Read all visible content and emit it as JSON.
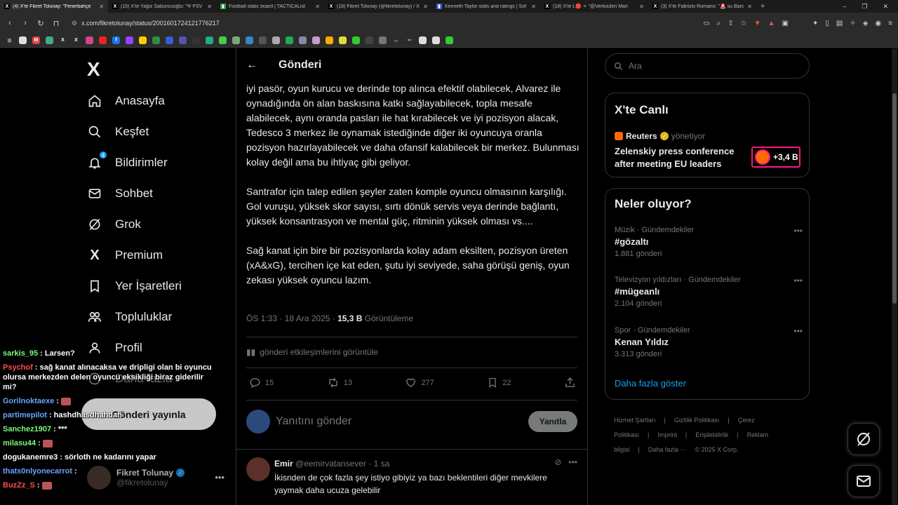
{
  "browser": {
    "tabs": [
      {
        "title": "(4) X'te Fikret Tolunay: \"Fenerbahçe",
        "fav": "X",
        "fav_color": "#000000",
        "active": true
      },
      {
        "title": "(15) X'te Yağız Sabuncuoğlu: \"Ψ PSV",
        "fav": "X",
        "fav_color": "#000000",
        "active": false
      },
      {
        "title": "Football static board | TACTICAList",
        "fav": "▮",
        "fav_color": "#2e9e44",
        "active": false
      },
      {
        "title": "(18) Fikret Tolunay (@fikretolunay) / X",
        "fav": "X",
        "fav_color": "#000000",
        "active": false
      },
      {
        "title": "Kenneth Taylor stats and ratings | Sof",
        "fav": "▮",
        "fav_color": "#3a5bd9",
        "active": false
      },
      {
        "title": "(18) X'te L🔴 ⚪ \"@Verkoulen Mari",
        "fav": "X",
        "fav_color": "#000000",
        "active": false
      },
      {
        "title": "(3) X'te Fabrizio Romano: \"🚨 su Barc",
        "fav": "X",
        "fav_color": "#000000",
        "active": false
      }
    ],
    "new_tab": "+",
    "window_controls": [
      "–",
      "❐",
      "✕"
    ],
    "url": "x.com/fikretolunay/status/2001601724121776217"
  },
  "nav": {
    "logo": "X",
    "items": [
      {
        "label": "Anasayfa",
        "icon": "home-icon"
      },
      {
        "label": "Keşfet",
        "icon": "search-icon"
      },
      {
        "label": "Bildirimler",
        "icon": "bell-icon",
        "badge": "4"
      },
      {
        "label": "Sohbet",
        "icon": "mail-icon"
      },
      {
        "label": "Grok",
        "icon": "grok-icon"
      },
      {
        "label": "Premium",
        "icon": "x-premium-icon"
      },
      {
        "label": "Yer İşaretleri",
        "icon": "bookmark-icon"
      },
      {
        "label": "Topluluklar",
        "icon": "people-icon"
      },
      {
        "label": "Profil",
        "icon": "person-icon"
      },
      {
        "label": "Daha fazla",
        "icon": "more-circle-icon"
      }
    ],
    "post_button": "Gönderi yayınla",
    "profile": {
      "name": "Fikret Tolunay",
      "handle": "@fikretolunay",
      "more": "•••"
    }
  },
  "chat": [
    {
      "user": "sarkis_95",
      "color": "#7cfc7c",
      "text": ": Larsen?"
    },
    {
      "user": "Psychof",
      "color": "#ff4d4d",
      "text": ": sağ kanat alınacaksa ve dripligi olan bi oyuncu olursa merkezden delen oyuncu eksikliği biraz giderilir mi?"
    },
    {
      "user": "Gorilnoktaexe",
      "color": "#6aa3ff",
      "text": ": ",
      "emote": true
    },
    {
      "user": "partimepilot",
      "color": "#6aa3ff",
      "text": ": hashdhasdhahdah"
    },
    {
      "user": "Sanchez1907",
      "color": "#7cfc7c",
      "text": ": ***"
    },
    {
      "user": "milasu44",
      "color": "#7cfc7c",
      "text": ": ",
      "emote": true
    },
    {
      "user": "dogukanemre3",
      "color": "#ffffff",
      "text": ": sörloth ne kadarını yapar"
    },
    {
      "user": "thats0nlyonecarrot",
      "color": "#6aa3ff",
      "text": ":"
    },
    {
      "user": "BuzZz_S",
      "color": "#ff4d4d",
      "text": ": ",
      "emote": true
    }
  ],
  "main": {
    "header_title": "Gönderi",
    "paragraphs": [
      "iyi pasör, oyun kurucu ve derinde top alınca efektif olabilecek, Alvarez ile oynadığında ön alan baskısına katkı sağlayabilecek, topla mesafe alabilecek, aynı oranda pasları ile hat kırabilecek ve iyi pozisyon alacak, Tedesco 3 merkez ile oynamak istediğinde diğer iki oyuncuya oranla pozisyon hazırlayabilecek ve daha ofansif kalabilecek bir merkez. Bulunması kolay değil ama bu ihtiyaç gibi geliyor.",
      "Santrafor için talep edilen şeyler zaten komple oyuncu olmasının karşılığı. Gol vuruşu, yüksek skor sayısı, sırtı dönük servis veya derinde bağlantı, yüksek konsantrasyon ve mental güç, ritminin yüksek olması vs....",
      "Sağ kanat için bire bir pozisyonlarda kolay adam eksilten, pozisyon üreten (xA&xG), tercihen içe kat eden, şutu iyi seviyede, saha görüşü geniş, oyun zekası yüksek oyuncu lazım."
    ],
    "meta_time": "ÖS 1:33 · 18 Ara 2025 · ",
    "meta_views": "15,3 B",
    "meta_views_label": " Görüntüleme",
    "engagement_link": "gönderi etkileşimlerini görüntüle",
    "actions": {
      "replies": "15",
      "reposts": "13",
      "likes": "277",
      "bookmarks": "22"
    },
    "reply_placeholder": "Yanıtını gönder",
    "reply_button": "Yanıtla",
    "comment": {
      "name": "Emir",
      "handle": "@eemirvatansever",
      "time": "· 1 sa",
      "text": "İkisnden de çok fazla şey istiyo gibiyiz ya bazı beklentileri diğer mevkilere yaymak daha ucuza gelebilir"
    }
  },
  "right": {
    "search_placeholder": "Ara",
    "live": {
      "title": "X'te Canlı",
      "host": "Reuters",
      "host_suffix": "yönetiyor",
      "headline": "Zelenskiy press conference after meeting EU leaders",
      "listeners": "+3,4 B"
    },
    "trends": {
      "title": "Neler oluyor?",
      "items": [
        {
          "category": "Müzik · Gündemdekiler",
          "name": "#gözaltı",
          "count": "1.881 gönderi"
        },
        {
          "category": "Televizyon yıldızları · Gündemdekiler",
          "name": "#mügeanlı",
          "count": "2.104 gönderi"
        },
        {
          "category": "Spor · Gündemdekiler",
          "name": "Kenan Yıldız",
          "count": "3.313 gönderi"
        }
      ],
      "show_more": "Daha fazla göster"
    },
    "footer": [
      "Hizmet Şartları",
      "|",
      "Gizlilik Politikası",
      "|",
      "Çerez Politikası",
      "|",
      "Imprint",
      "|",
      "Erişilebilirlik",
      "|",
      "Reklam bilgisi",
      "|",
      "Daha fazla ···",
      "© 2025 X Corp."
    ]
  }
}
